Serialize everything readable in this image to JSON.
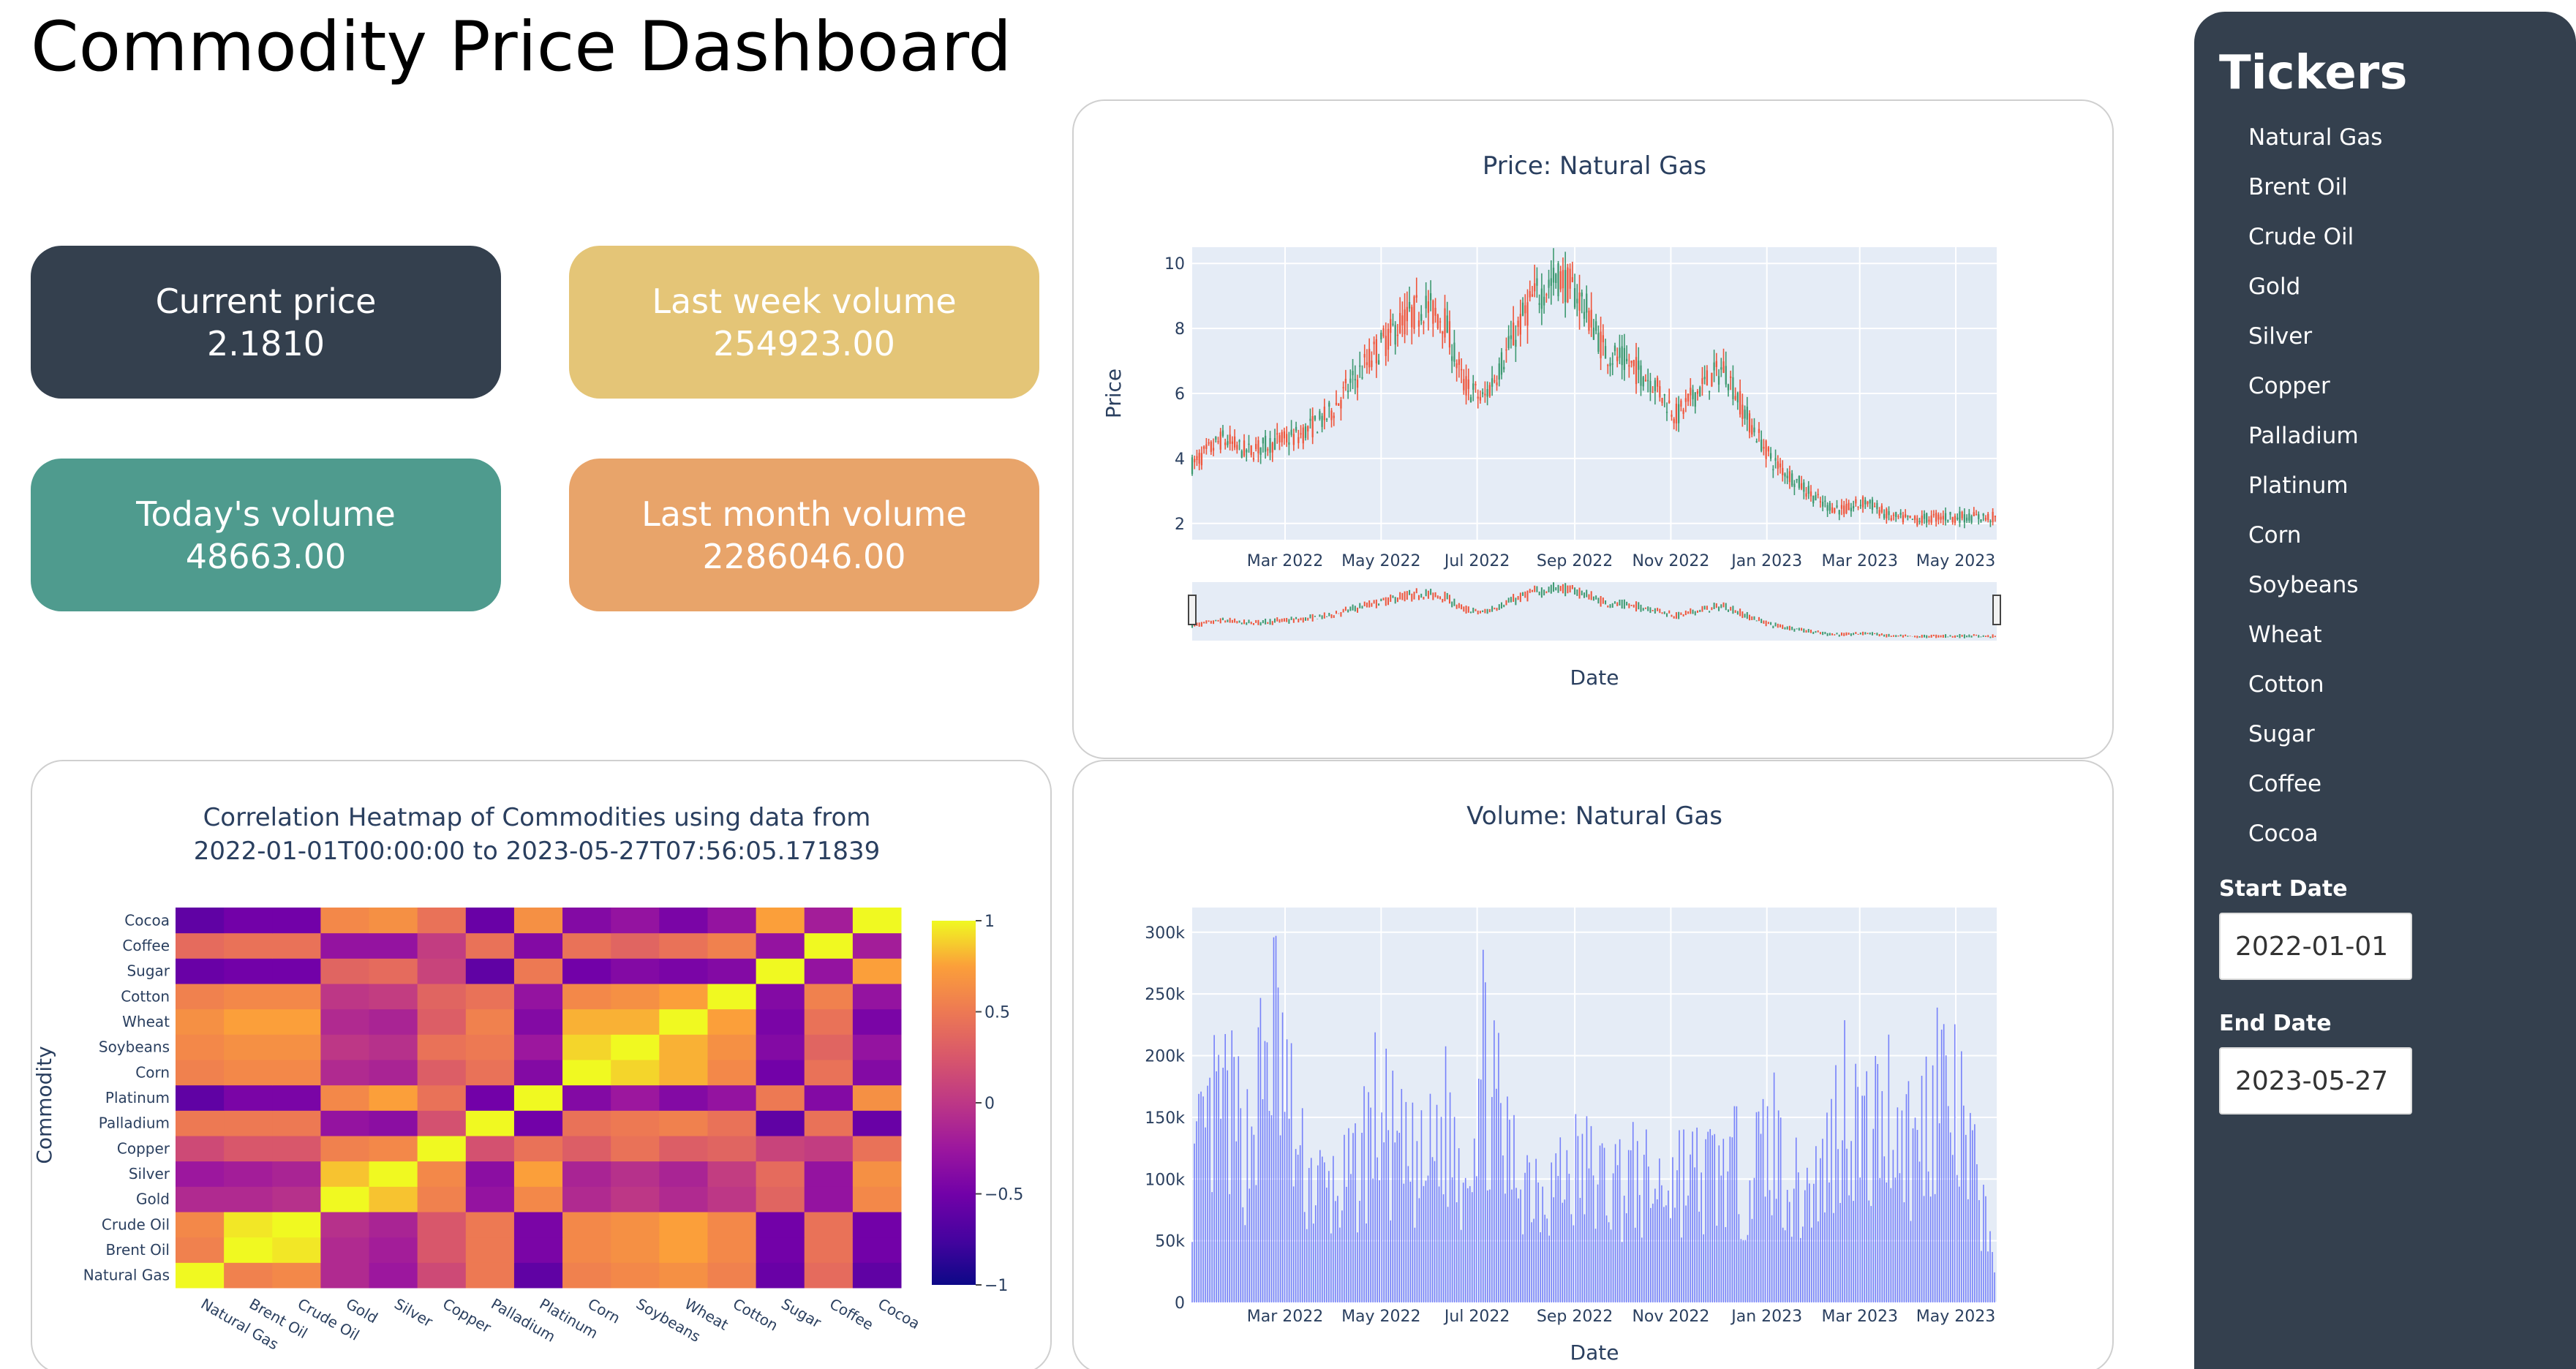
{
  "header": {
    "title": "Commodity Price Dashboard"
  },
  "cards": {
    "current_price": {
      "label": "Current price",
      "value": "2.1810"
    },
    "last_week_volume": {
      "label": "Last week volume",
      "value": "254923.00"
    },
    "todays_volume": {
      "label": "Today's volume",
      "value": "48663.00"
    },
    "last_month_volume": {
      "label": "Last month volume",
      "value": "2286046.00"
    }
  },
  "colors": {
    "sidebar": "#34404e",
    "card_current_price": "#34404e",
    "card_last_week_volume": "#e4c577",
    "card_todays_volume": "#4f9b8e",
    "card_last_month_volume": "#e8a46a",
    "candle_up": "#3d9970",
    "candle_down": "#ef553b",
    "volume_bar": "#636efa",
    "plot_bg": "#e5ecf6"
  },
  "sidebar": {
    "title": "Tickers",
    "tickers": [
      "Natural Gas",
      "Brent Oil",
      "Crude Oil",
      "Gold",
      "Silver",
      "Copper",
      "Palladium",
      "Platinum",
      "Corn",
      "Soybeans",
      "Wheat",
      "Cotton",
      "Sugar",
      "Coffee",
      "Cocoa"
    ],
    "start_date_label": "Start Date",
    "start_date_value": "2022-01-01",
    "end_date_label": "End Date",
    "end_date_value": "2023-05-27"
  },
  "chart_data": [
    {
      "type": "candlestick",
      "title": "Price: Natural Gas",
      "xlabel": "Date",
      "ylabel": "Price",
      "x_tick_labels": [
        "Mar 2022",
        "May 2022",
        "Jul 2022",
        "Sep 2022",
        "Nov 2022",
        "Jan 2023",
        "Mar 2023",
        "May 2023"
      ],
      "y_ticks": [
        2,
        4,
        6,
        8,
        10
      ],
      "ylim": [
        1.5,
        10.5
      ],
      "xlim": [
        "2022-01-01",
        "2023-05-27"
      ],
      "range_slider": true,
      "series": [
        {
          "x": [
            "2022-01-01",
            "2022-01-20",
            "2022-02-05",
            "2022-02-22",
            "2022-03-10",
            "2022-03-28",
            "2022-04-12",
            "2022-04-28",
            "2022-05-12",
            "2022-05-28",
            "2022-06-10",
            "2022-06-22",
            "2022-07-05",
            "2022-07-20",
            "2022-08-05",
            "2022-08-22",
            "2022-09-05",
            "2022-09-20",
            "2022-10-05",
            "2022-10-20",
            "2022-11-05",
            "2022-11-20",
            "2022-12-05",
            "2022-12-20",
            "2023-01-05",
            "2023-01-20",
            "2023-02-05",
            "2023-02-20",
            "2023-03-05",
            "2023-03-20",
            "2023-04-05",
            "2023-04-20",
            "2023-05-05",
            "2023-05-27"
          ],
          "close": [
            3.8,
            4.6,
            4.2,
            4.5,
            4.7,
            5.3,
            6.3,
            7.3,
            8.1,
            8.7,
            8.3,
            6.3,
            5.8,
            7.3,
            8.9,
            9.6,
            8.9,
            7.3,
            6.9,
            6.4,
            5.3,
            6.2,
            6.8,
            5.2,
            3.9,
            3.3,
            2.6,
            2.4,
            2.7,
            2.2,
            2.1,
            2.2,
            2.2,
            2.18
          ]
        }
      ]
    },
    {
      "type": "heatmap",
      "title": "Correlation Heatmap of Commodities using data from",
      "subtitle": "2022-01-01T00:00:00 to 2023-05-27T07:56:05.171839",
      "ylabel": "Commodity",
      "labels": [
        "Natural Gas",
        "Brent Oil",
        "Crude Oil",
        "Gold",
        "Silver",
        "Copper",
        "Palladium",
        "Platinum",
        "Corn",
        "Soybeans",
        "Wheat",
        "Cotton",
        "Sugar",
        "Coffee",
        "Cocoa"
      ],
      "colorbar_ticks": [
        "1",
        "0.5",
        "0",
        "−0.5",
        "−1"
      ],
      "zlim": [
        -1,
        1
      ],
      "z": [
        [
          1.0,
          0.55,
          0.6,
          -0.1,
          -0.25,
          0.15,
          0.5,
          -0.6,
          0.55,
          0.6,
          0.65,
          0.55,
          -0.55,
          0.4,
          -0.6
        ],
        [
          0.55,
          1.0,
          0.95,
          -0.1,
          -0.2,
          0.25,
          0.5,
          -0.45,
          0.6,
          0.65,
          0.75,
          0.6,
          -0.5,
          0.45,
          -0.5
        ],
        [
          0.6,
          0.95,
          1.0,
          -0.05,
          -0.15,
          0.25,
          0.5,
          -0.45,
          0.6,
          0.65,
          0.75,
          0.6,
          -0.5,
          0.45,
          -0.5
        ],
        [
          -0.1,
          -0.1,
          -0.05,
          1.0,
          0.85,
          0.55,
          -0.3,
          0.6,
          -0.1,
          0.0,
          -0.1,
          0.0,
          0.35,
          -0.3,
          0.6
        ],
        [
          -0.25,
          -0.2,
          -0.15,
          0.85,
          1.0,
          0.6,
          -0.35,
          0.75,
          -0.15,
          -0.05,
          -0.15,
          0.05,
          0.4,
          -0.3,
          0.65
        ],
        [
          0.15,
          0.25,
          0.25,
          0.55,
          0.6,
          1.0,
          0.2,
          0.45,
          0.3,
          0.45,
          0.3,
          0.35,
          0.1,
          0.05,
          0.45
        ],
        [
          0.5,
          0.5,
          0.5,
          -0.3,
          -0.35,
          0.2,
          1.0,
          -0.5,
          0.45,
          0.5,
          0.55,
          0.45,
          -0.6,
          0.45,
          -0.55
        ],
        [
          -0.6,
          -0.45,
          -0.45,
          0.6,
          0.75,
          0.45,
          -0.5,
          1.0,
          -0.4,
          -0.25,
          -0.4,
          -0.3,
          0.5,
          -0.4,
          0.65
        ],
        [
          0.55,
          0.6,
          0.6,
          -0.1,
          -0.15,
          0.3,
          0.45,
          -0.4,
          1.0,
          0.9,
          0.8,
          0.6,
          -0.5,
          0.45,
          -0.4
        ],
        [
          0.6,
          0.65,
          0.65,
          0.0,
          -0.05,
          0.45,
          0.5,
          -0.25,
          0.9,
          1.0,
          0.8,
          0.65,
          -0.4,
          0.35,
          -0.3
        ],
        [
          0.65,
          0.75,
          0.75,
          -0.1,
          -0.15,
          0.3,
          0.55,
          -0.4,
          0.8,
          0.8,
          1.0,
          0.75,
          -0.45,
          0.45,
          -0.45
        ],
        [
          0.55,
          0.6,
          0.6,
          0.0,
          0.05,
          0.35,
          0.45,
          -0.3,
          0.6,
          0.65,
          0.75,
          1.0,
          -0.4,
          0.55,
          -0.3
        ],
        [
          -0.55,
          -0.5,
          -0.5,
          0.35,
          0.4,
          0.1,
          -0.6,
          0.5,
          -0.5,
          -0.4,
          -0.45,
          -0.4,
          1.0,
          -0.3,
          0.75
        ],
        [
          0.4,
          0.45,
          0.45,
          -0.3,
          -0.3,
          0.05,
          0.45,
          -0.4,
          0.45,
          0.35,
          0.45,
          0.55,
          -0.3,
          1.0,
          -0.2
        ],
        [
          -0.6,
          -0.5,
          -0.5,
          0.6,
          0.65,
          0.45,
          -0.55,
          0.65,
          -0.4,
          -0.3,
          -0.45,
          -0.3,
          0.75,
          -0.2,
          1.0
        ]
      ]
    },
    {
      "type": "bar",
      "title": "Volume: Natural Gas",
      "xlabel": "Date",
      "x_tick_labels": [
        "Mar 2022",
        "May 2022",
        "Jul 2022",
        "Sep 2022",
        "Nov 2022",
        "Jan 2023",
        "Mar 2023",
        "May 2023"
      ],
      "y_tick_labels": [
        "0",
        "50k",
        "100k",
        "150k",
        "200k",
        "250k",
        "300k"
      ],
      "ylim": [
        0,
        320000
      ],
      "xlim": [
        "2022-01-01",
        "2023-05-27"
      ],
      "series": [
        {
          "x": [
            "2022-01-01",
            "2022-01-20",
            "2022-02-05",
            "2022-02-22",
            "2022-03-10",
            "2022-03-28",
            "2022-04-12",
            "2022-04-28",
            "2022-05-12",
            "2022-05-28",
            "2022-06-10",
            "2022-06-22",
            "2022-07-05",
            "2022-07-20",
            "2022-08-05",
            "2022-08-22",
            "2022-09-05",
            "2022-09-20",
            "2022-10-05",
            "2022-10-20",
            "2022-11-05",
            "2022-11-20",
            "2022-12-05",
            "2022-12-20",
            "2023-01-05",
            "2023-01-20",
            "2023-02-05",
            "2023-02-20",
            "2023-03-05",
            "2023-03-20",
            "2023-04-05",
            "2023-04-20",
            "2023-05-05",
            "2023-05-27"
          ],
          "values": [
            140000,
            220000,
            175000,
            305000,
            150000,
            120000,
            130000,
            210000,
            160000,
            140000,
            200000,
            150000,
            270000,
            160000,
            140000,
            135000,
            150000,
            130000,
            140000,
            125000,
            145000,
            135000,
            150000,
            140000,
            180000,
            120000,
            140000,
            235000,
            175000,
            220000,
            165000,
            255000,
            185000,
            48663
          ]
        }
      ]
    }
  ]
}
